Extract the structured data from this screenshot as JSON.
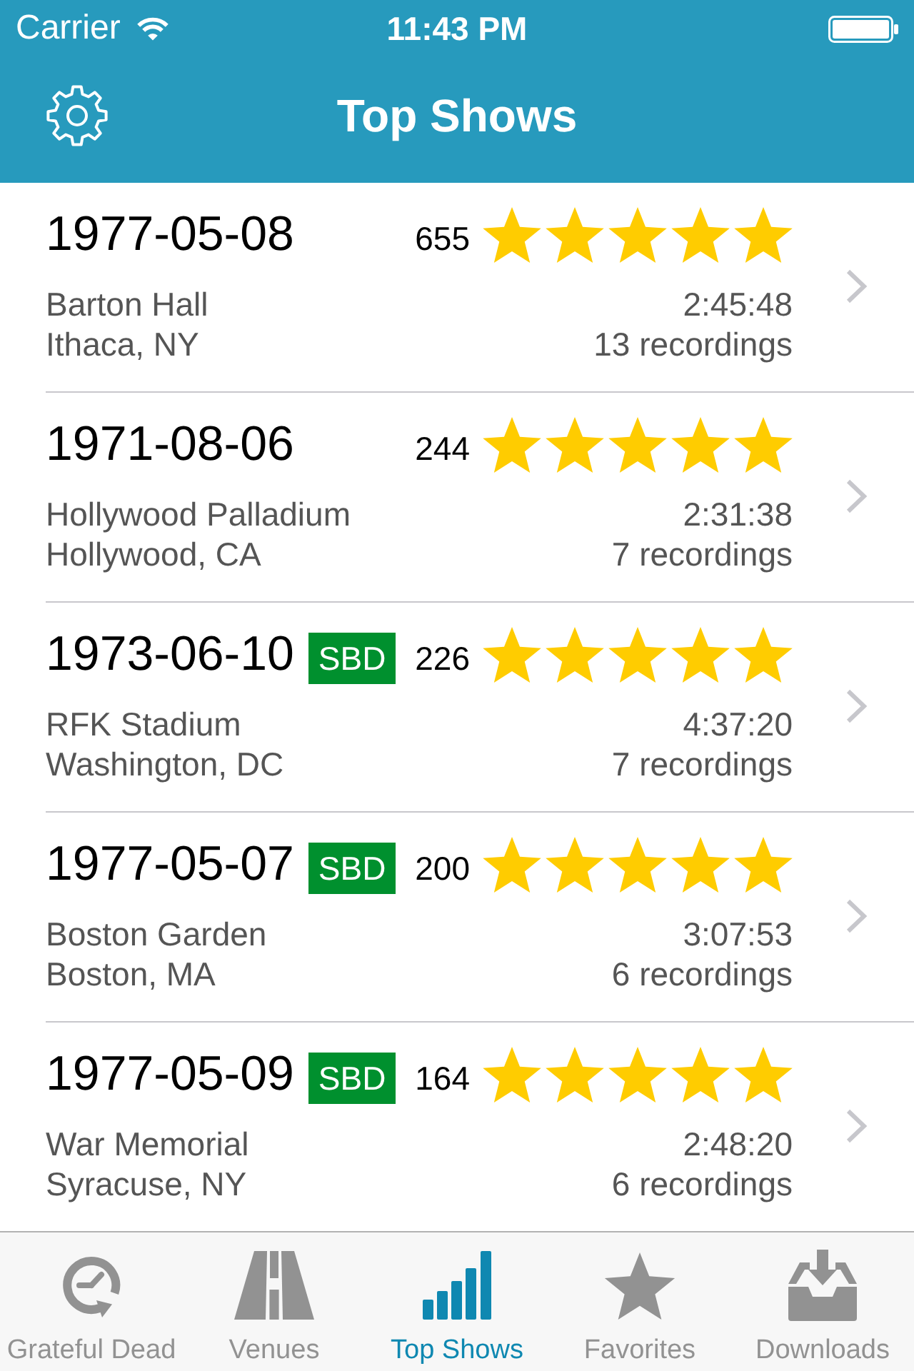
{
  "status_bar": {
    "carrier": "Carrier",
    "time": "11:43 PM"
  },
  "nav_bar": {
    "title": "Top Shows"
  },
  "shows": [
    {
      "date": "1977-05-08",
      "count": "655",
      "stars": 5,
      "venue": "Barton Hall",
      "location": "Ithaca, NY",
      "duration": "2:45:48",
      "recordings": "13 recordings"
    },
    {
      "date": "1971-08-06",
      "count": "244",
      "stars": 5,
      "venue": "Hollywood Palladium",
      "location": "Hollywood, CA",
      "duration": "2:31:38",
      "recordings": "7 recordings"
    },
    {
      "date": "1973-06-10",
      "badge": "SBD",
      "count": "226",
      "stars": 5,
      "venue": "RFK Stadium",
      "location": "Washington, DC",
      "duration": "4:37:20",
      "recordings": "7 recordings"
    },
    {
      "date": "1977-05-07",
      "badge": "SBD",
      "count": "200",
      "stars": 5,
      "venue": "Boston Garden",
      "location": "Boston, MA",
      "duration": "3:07:53",
      "recordings": "6 recordings"
    },
    {
      "date": "1977-05-09",
      "badge": "SBD",
      "count": "164",
      "stars": 5,
      "venue": "War Memorial",
      "location": "Syracuse, NY",
      "duration": "2:48:20",
      "recordings": "6 recordings"
    }
  ],
  "tab_bar": [
    {
      "label": "Grateful Dead",
      "kind": "history",
      "selected": false
    },
    {
      "label": "Venues",
      "kind": "road",
      "selected": false
    },
    {
      "label": "Top Shows",
      "kind": "chart",
      "selected": true
    },
    {
      "label": "Favorites",
      "kind": "star",
      "selected": false
    },
    {
      "label": "Downloads",
      "kind": "inbox",
      "selected": false
    }
  ]
}
